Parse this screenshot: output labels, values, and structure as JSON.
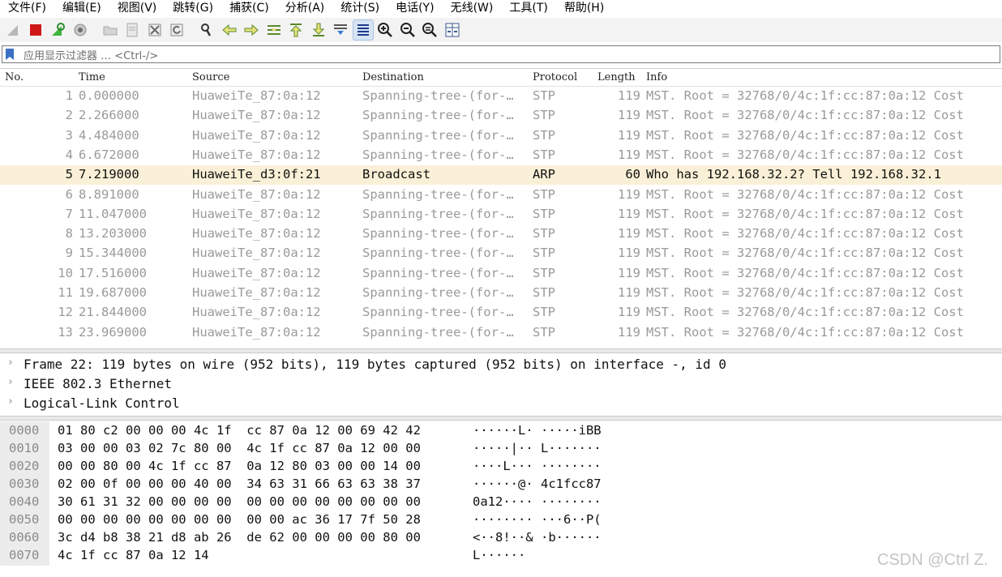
{
  "menu": [
    "文件(F)",
    "编辑(E)",
    "视图(V)",
    "跳转(G)",
    "捕获(C)",
    "分析(A)",
    "统计(S)",
    "电话(Y)",
    "无线(W)",
    "工具(T)",
    "帮助(H)"
  ],
  "toolbar": {
    "icons": [
      "shark-fin-start-icon",
      "stop-capture-icon",
      "restart-capture-icon",
      "capture-options-icon",
      "open-file-icon",
      "save-file-icon",
      "close-file-icon",
      "reload-file-icon",
      "find-packet-icon",
      "go-back-icon",
      "go-forward-icon",
      "go-to-packet-icon",
      "first-packet-icon",
      "last-packet-icon",
      "autoscroll-icon",
      "colorize-icon",
      "zoom-in-icon",
      "zoom-out-icon",
      "normal-size-icon",
      "resize-columns-icon"
    ]
  },
  "filter": {
    "placeholder": "应用显示过滤器 … <Ctrl-/>"
  },
  "packet_list": {
    "columns": [
      "No.",
      "Time",
      "Source",
      "Destination",
      "Protocol",
      "Length",
      "Info"
    ],
    "rows": [
      {
        "no": "1",
        "time": "0.000000",
        "src": "HuaweiTe_87:0a:12",
        "dst": "Spanning-tree-(for-…",
        "proto": "STP",
        "len": "119",
        "info": "MST. Root = 32768/0/4c:1f:cc:87:0a:12  Cost"
      },
      {
        "no": "2",
        "time": "2.266000",
        "src": "HuaweiTe_87:0a:12",
        "dst": "Spanning-tree-(for-…",
        "proto": "STP",
        "len": "119",
        "info": "MST. Root = 32768/0/4c:1f:cc:87:0a:12  Cost"
      },
      {
        "no": "3",
        "time": "4.484000",
        "src": "HuaweiTe_87:0a:12",
        "dst": "Spanning-tree-(for-…",
        "proto": "STP",
        "len": "119",
        "info": "MST. Root = 32768/0/4c:1f:cc:87:0a:12  Cost"
      },
      {
        "no": "4",
        "time": "6.672000",
        "src": "HuaweiTe_87:0a:12",
        "dst": "Spanning-tree-(for-…",
        "proto": "STP",
        "len": "119",
        "info": "MST. Root = 32768/0/4c:1f:cc:87:0a:12  Cost"
      },
      {
        "no": "5",
        "time": "7.219000",
        "src": "HuaweiTe_d3:0f:21",
        "dst": "Broadcast",
        "proto": "ARP",
        "len": "60",
        "info": "Who has 192.168.32.2? Tell 192.168.32.1",
        "selected": true
      },
      {
        "no": "6",
        "time": "8.891000",
        "src": "HuaweiTe_87:0a:12",
        "dst": "Spanning-tree-(for-…",
        "proto": "STP",
        "len": "119",
        "info": "MST. Root = 32768/0/4c:1f:cc:87:0a:12  Cost"
      },
      {
        "no": "7",
        "time": "11.047000",
        "src": "HuaweiTe_87:0a:12",
        "dst": "Spanning-tree-(for-…",
        "proto": "STP",
        "len": "119",
        "info": "MST. Root = 32768/0/4c:1f:cc:87:0a:12  Cost"
      },
      {
        "no": "8",
        "time": "13.203000",
        "src": "HuaweiTe_87:0a:12",
        "dst": "Spanning-tree-(for-…",
        "proto": "STP",
        "len": "119",
        "info": "MST. Root = 32768/0/4c:1f:cc:87:0a:12  Cost"
      },
      {
        "no": "9",
        "time": "15.344000",
        "src": "HuaweiTe_87:0a:12",
        "dst": "Spanning-tree-(for-…",
        "proto": "STP",
        "len": "119",
        "info": "MST. Root = 32768/0/4c:1f:cc:87:0a:12  Cost"
      },
      {
        "no": "10",
        "time": "17.516000",
        "src": "HuaweiTe_87:0a:12",
        "dst": "Spanning-tree-(for-…",
        "proto": "STP",
        "len": "119",
        "info": "MST. Root = 32768/0/4c:1f:cc:87:0a:12  Cost"
      },
      {
        "no": "11",
        "time": "19.687000",
        "src": "HuaweiTe_87:0a:12",
        "dst": "Spanning-tree-(for-…",
        "proto": "STP",
        "len": "119",
        "info": "MST. Root = 32768/0/4c:1f:cc:87:0a:12  Cost"
      },
      {
        "no": "12",
        "time": "21.844000",
        "src": "HuaweiTe_87:0a:12",
        "dst": "Spanning-tree-(for-…",
        "proto": "STP",
        "len": "119",
        "info": "MST. Root = 32768/0/4c:1f:cc:87:0a:12  Cost"
      },
      {
        "no": "13",
        "time": "23.969000",
        "src": "HuaweiTe_87:0a:12",
        "dst": "Spanning-tree-(for-…",
        "proto": "STP",
        "len": "119",
        "info": "MST. Root = 32768/0/4c:1f:cc:87:0a:12  Cost"
      }
    ]
  },
  "details": [
    "Frame 22: 119 bytes on wire (952 bits), 119 bytes captured (952 bits) on interface -, id 0",
    "IEEE 802.3 Ethernet",
    "Logical-Link Control"
  ],
  "bytes": [
    {
      "offset": "0000",
      "hex": "01 80 c2 00 00 00 4c 1f  cc 87 0a 12 00 69 42 42",
      "ascii": "······L· ·····iBB"
    },
    {
      "offset": "0010",
      "hex": "03 00 00 03 02 7c 80 00  4c 1f cc 87 0a 12 00 00",
      "ascii": "·····|·· L·······"
    },
    {
      "offset": "0020",
      "hex": "00 00 80 00 4c 1f cc 87  0a 12 80 03 00 00 14 00",
      "ascii": "····L··· ········"
    },
    {
      "offset": "0030",
      "hex": "02 00 0f 00 00 00 40 00  34 63 31 66 63 63 38 37",
      "ascii": "······@· 4c1fcc87"
    },
    {
      "offset": "0040",
      "hex": "30 61 31 32 00 00 00 00  00 00 00 00 00 00 00 00",
      "ascii": "0a12···· ········"
    },
    {
      "offset": "0050",
      "hex": "00 00 00 00 00 00 00 00  00 00 ac 36 17 7f 50 28",
      "ascii": "········ ···6··P("
    },
    {
      "offset": "0060",
      "hex": "3c d4 b8 38 21 d8 ab 26  de 62 00 00 00 00 80 00",
      "ascii": "<··8!··& ·b······"
    },
    {
      "offset": "0070",
      "hex": "4c 1f cc 87 0a 12 14",
      "ascii": "L······"
    }
  ],
  "watermark": "CSDN @Ctrl Z."
}
